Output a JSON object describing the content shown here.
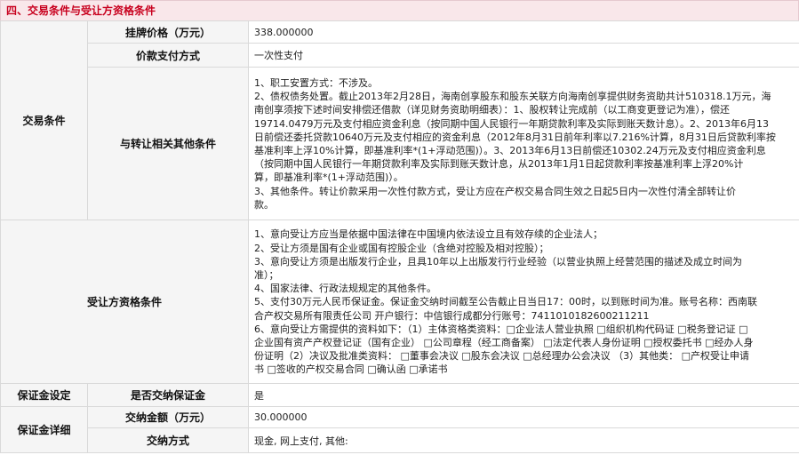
{
  "section": {
    "title": "四、交易条件与受让方资格条件"
  },
  "trade": {
    "category": "交易条件",
    "list_price": {
      "label": "挂牌价格（万元）",
      "value": "338.000000"
    },
    "payment": {
      "label": "价款支付方式",
      "value": "一次性支付"
    },
    "other": {
      "label": "与转让相关其他条件",
      "lines": [
        "1、职工安置方式：不涉及。",
        "2、债权债务处置。截止2013年2月28日，海南创享股东和股东关联方向海南创享提供财务资助共计510318.1万元，海",
        "南创享须按下述时间安排偿还借款（详见财务资助明细表）：1、股权转让完成前（以工商变更登记为准），偿还",
        "19714.0479万元及支付相应资金利息（按同期中国人民银行一年期贷款利率及实际到账天数计息）。2、2013年6月13",
        "日前偿还委托贷款10640万元及支付相应的资金利息（2012年8月31日前年利率以7.216%计算，8月31日后贷款利率按",
        "基准利率上浮10%计算，即基准利率*(1+浮动范围)）。3、2013年6月13日前偿还10302.24万元及支付相应资金利息",
        "（按同期中国人民银行一年期贷款利率及实际到账天数计息，从2013年1月1日起贷款利率按基准利率上浮20%计",
        "算，即基准利率*(1+浮动范围)）。",
        "3、其他条件。转让价款采用一次性付款方式，受让方应在产权交易合同生效之日起5日内一次性付清全部转让价",
        "款。"
      ]
    }
  },
  "qualification": {
    "label": "受让方资格条件",
    "lines": [
      "1、意向受让方应当是依据中国法律在中国境内依法设立且有效存续的企业法人；",
      "2、受让方须是国有企业或国有控股企业（含绝对控股及相对控股）；",
      "3、意向受让方须是出版发行企业，且具10年以上出版发行行业经验（以营业执照上经营范围的描述及成立时间为",
      "准）；",
      "4、国家法律、行政法规规定的其他条件。",
      "5、支付30万元人民币保证金。保证金交纳时间截至公告截止日当日17：00时，以到账时间为准。账号名称：西南联",
      "合产权交易所有限责任公司 开户银行：中信银行成都分行账号：7411010182600211211",
      "6、意向受让方需提供的资料如下：（1）主体资格类资料：□企业法人营业执照 □组织机构代码证 □税务登记证 □",
      "企业国有资产产权登记证（国有企业） □公司章程（经工商备案） □法定代表人身份证明 □授权委托书 □经办人身",
      "份证明（2）决议及批准类资料： □董事会决议 □股东会决议 □总经理办公会决议 （3）其他类： □产权受让申请",
      "书 □签收的产权交易合同 □确认函 □承诺书"
    ]
  },
  "deposit_setting": {
    "category": "保证金设定",
    "label": "是否交纳保证金",
    "value": "是"
  },
  "deposit_detail": {
    "category": "保证金详细",
    "amount": {
      "label": "交纳金额（万元）",
      "value": "30.000000"
    },
    "method": {
      "label": "交纳方式",
      "value": "现金, 网上支付, 其他:"
    }
  }
}
